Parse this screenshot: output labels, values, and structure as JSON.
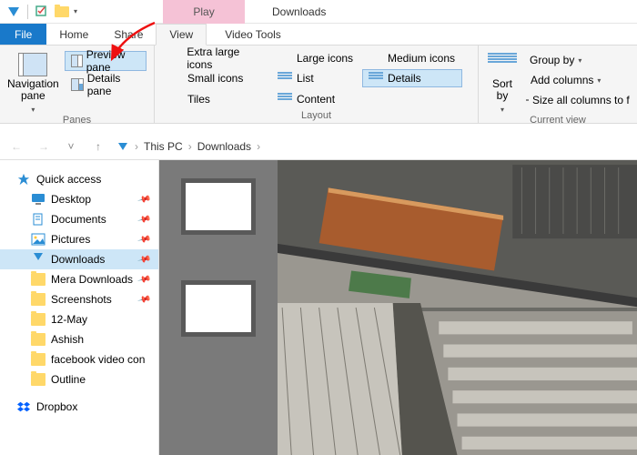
{
  "window": {
    "title": "Downloads",
    "contextual_tab": "Play"
  },
  "tabs": {
    "file": "File",
    "home": "Home",
    "share": "Share",
    "view": "View",
    "video_tools": "Video Tools"
  },
  "ribbon": {
    "panes": {
      "label": "Panes",
      "navigation": "Navigation pane",
      "preview": "Preview pane",
      "details": "Details pane"
    },
    "layout": {
      "label": "Layout",
      "extra_large": "Extra large icons",
      "large": "Large icons",
      "medium": "Medium icons",
      "small": "Small icons",
      "list": "List",
      "details": "Details",
      "tiles": "Tiles",
      "content": "Content"
    },
    "current_view": {
      "label": "Current view",
      "sort": "Sort by",
      "group": "Group by",
      "add_columns": "Add columns",
      "size_all": "Size all columns to f"
    }
  },
  "breadcrumb": {
    "root": "This PC",
    "leaf": "Downloads"
  },
  "sidebar": {
    "quick_access": "Quick access",
    "items": [
      {
        "label": "Desktop",
        "pinned": true
      },
      {
        "label": "Documents",
        "pinned": true
      },
      {
        "label": "Pictures",
        "pinned": true
      },
      {
        "label": "Downloads",
        "pinned": true,
        "selected": true
      },
      {
        "label": "Mera Downloads",
        "pinned": true
      },
      {
        "label": "Screenshots",
        "pinned": true
      },
      {
        "label": "12-May",
        "pinned": false
      },
      {
        "label": "Ashish",
        "pinned": false
      },
      {
        "label": "facebook video con",
        "pinned": false
      },
      {
        "label": "Outline",
        "pinned": false
      }
    ],
    "dropbox": "Dropbox"
  }
}
